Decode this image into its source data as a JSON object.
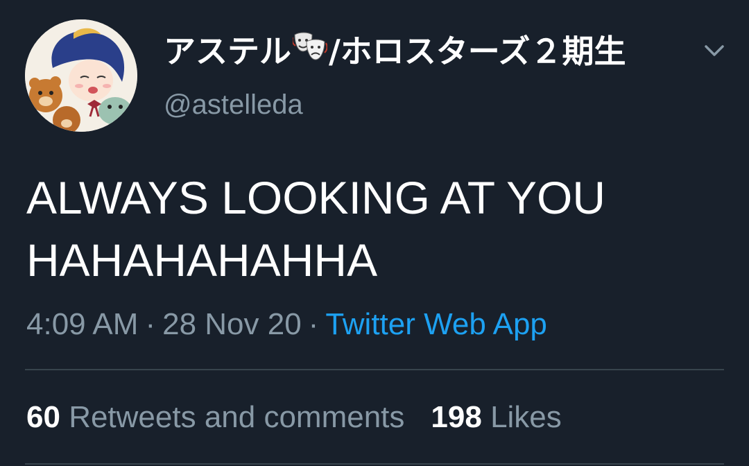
{
  "user": {
    "display_name_prefix": "アステル",
    "display_name_suffix": "/ホロスターズ２期生",
    "name_emoji": "theater-masks-icon",
    "handle": "@astelleda"
  },
  "tweet": {
    "text_line1": "ALWAYS LOOKING AT YOU",
    "text_line2": "HAHAHAHAHHA"
  },
  "meta": {
    "time": "4:09 AM",
    "separator": "·",
    "date": "28 Nov 20",
    "source": "Twitter Web App"
  },
  "stats": {
    "retweets_count": "60",
    "retweets_label": "Retweets and comments",
    "likes_count": "198",
    "likes_label": "Likes"
  },
  "colors": {
    "background": "#18202b",
    "primary_text": "#ffffff",
    "secondary_text": "#8899a6",
    "link": "#1da1f2",
    "divider": "#38444d"
  },
  "icons": {
    "menu": "chevron-down-icon"
  }
}
